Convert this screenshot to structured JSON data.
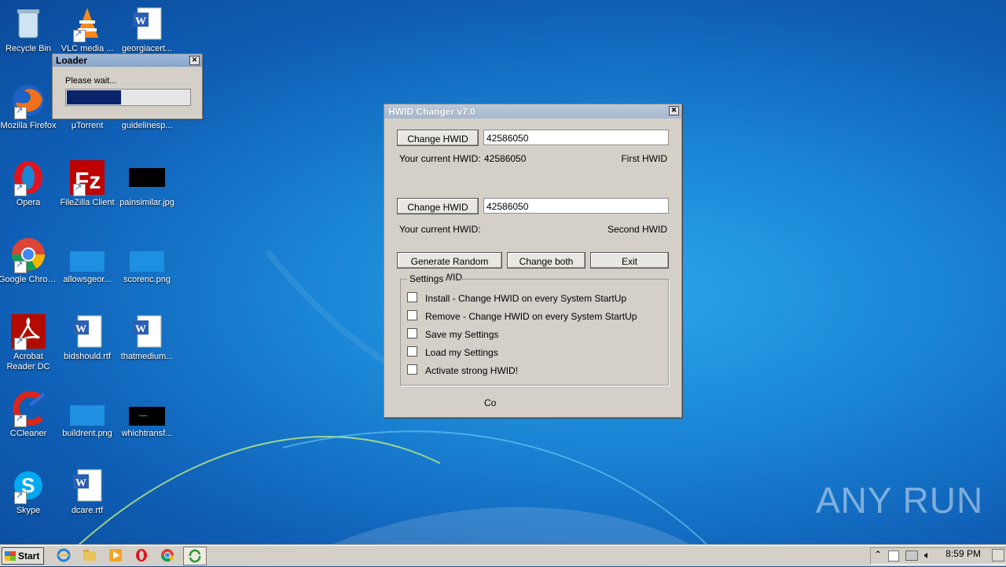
{
  "desktop": {
    "icons": [
      {
        "label": "Recycle Bin",
        "icon": "recycle-bin-icon"
      },
      {
        "label": "VLC media ...",
        "icon": "vlc-icon"
      },
      {
        "label": "georgiacert...",
        "icon": "word-doc-icon"
      },
      {
        "label": "Mozilla Firefox",
        "icon": "firefox-icon"
      },
      {
        "label": "µTorrent",
        "icon": "utorrent-icon"
      },
      {
        "label": "guidelinesp...",
        "icon": "file-icon"
      },
      {
        "label": "Opera",
        "icon": "opera-icon"
      },
      {
        "label": "FileZilla Client",
        "icon": "filezilla-icon"
      },
      {
        "label": "painsimilar.jpg",
        "icon": "image-icon"
      },
      {
        "label": "Google Chrome",
        "icon": "chrome-icon"
      },
      {
        "label": "allowsgeor...",
        "icon": "file-icon"
      },
      {
        "label": "scorenc.png",
        "icon": "image-icon"
      },
      {
        "label": "Acrobat Reader DC",
        "icon": "acrobat-icon"
      },
      {
        "label": "bidshould.rtf",
        "icon": "word-doc-icon"
      },
      {
        "label": "thatmedium...",
        "icon": "word-doc-icon"
      },
      {
        "label": "CCleaner",
        "icon": "ccleaner-icon"
      },
      {
        "label": "buildrent.png",
        "icon": "image-icon"
      },
      {
        "label": "whichtransf...",
        "icon": "image-icon"
      },
      {
        "label": "Skype",
        "icon": "skype-icon"
      },
      {
        "label": "dcare.rtf",
        "icon": "word-doc-icon"
      }
    ]
  },
  "loader": {
    "title": "Loader",
    "message": "Please wait...",
    "progress": 0.44
  },
  "hwid": {
    "title": "HWID Changer v7.0",
    "change_btn_1": "Change HWID",
    "input_1": "42586050",
    "current_label_1": "Your current HWID:",
    "current_value_1": "42586050",
    "first_label": "First HWID",
    "change_btn_2": "Change HWID",
    "input_2": "42586050",
    "current_label_2": "Your current HWID:",
    "second_label": "Second HWID",
    "generate_btn": "Generate Random HWID",
    "change_both_btn": "Change both",
    "exit_btn": "Exit",
    "settings_legend": "Settings",
    "settings": [
      "Install - Change HWID on every System StartUp",
      "Remove - Change HWID on every System StartUp",
      "Save my Settings",
      "Load my Settings",
      "Activate strong HWID!"
    ],
    "footer": "Co"
  },
  "taskbar": {
    "start_label": "Start",
    "clock": "8:59 PM"
  },
  "watermark": "ANY RUN"
}
